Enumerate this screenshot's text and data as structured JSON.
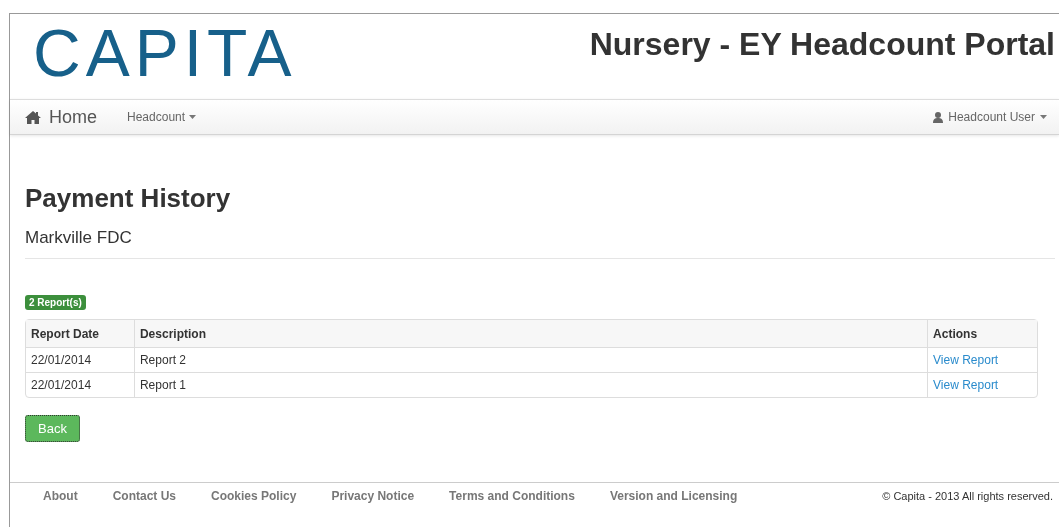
{
  "header": {
    "logo": "CAPITA",
    "title": "Nursery - EY Headcount Portal"
  },
  "navbar": {
    "home": "Home",
    "menus": [
      {
        "label": "Headcount"
      }
    ],
    "user": "Headcount User"
  },
  "page": {
    "heading": "Payment History",
    "subheading": "Markville FDC",
    "count_badge": "2 Report(s)"
  },
  "table": {
    "columns": [
      "Report Date",
      "Description",
      "Actions"
    ],
    "rows": [
      {
        "date": "22/01/2014",
        "description": "Report 2",
        "action": "View Report"
      },
      {
        "date": "22/01/2014",
        "description": "Report 1",
        "action": "View Report"
      }
    ]
  },
  "back_button": "Back",
  "footer": {
    "links": [
      "About",
      "Contact Us",
      "Cookies Policy",
      "Privacy Notice",
      "Terms and Conditions",
      "Version and Licensing"
    ],
    "copyright": "© Capita - 2013 All rights reserved."
  }
}
